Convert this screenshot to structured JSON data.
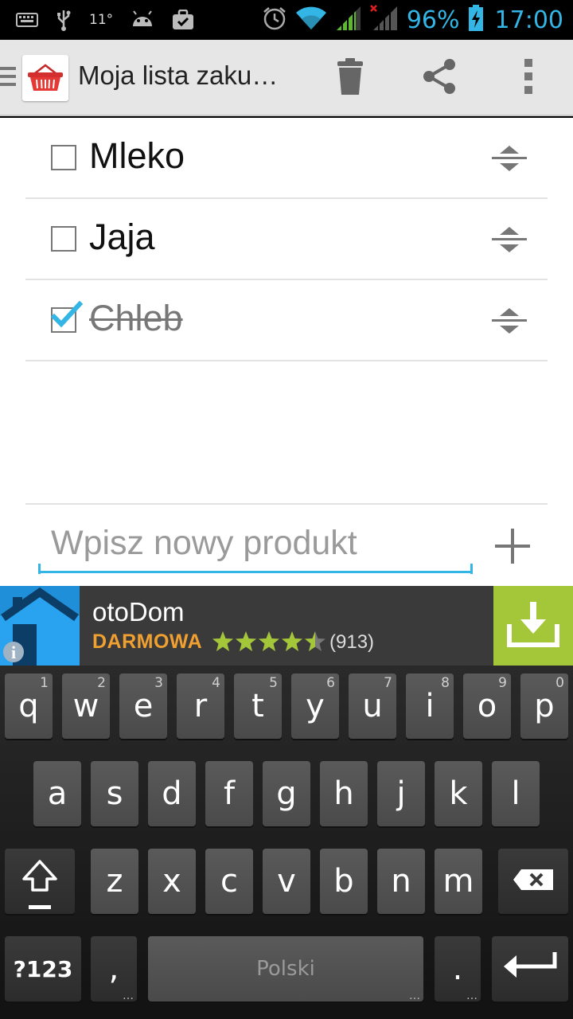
{
  "status_bar": {
    "temperature": "11°",
    "battery_percent": "96%",
    "time": "17:00",
    "icons": [
      "keyboard-icon",
      "usb-icon",
      "android-icon",
      "briefcase-icon",
      "alarm-icon",
      "wifi-icon",
      "signal-icon",
      "signal-no-service-icon",
      "battery-charging-icon"
    ]
  },
  "action_bar": {
    "title": "Moja lista zaku…",
    "actions": [
      "delete-icon",
      "share-icon",
      "overflow-menu-icon"
    ]
  },
  "list": {
    "items": [
      {
        "label": "Mleko",
        "checked": false
      },
      {
        "label": "Jaja",
        "checked": false
      },
      {
        "label": "Chleb",
        "checked": true
      }
    ]
  },
  "new_item": {
    "placeholder": "Wpisz nowy produkt",
    "value": ""
  },
  "ad": {
    "title": "otoDom",
    "price": "DARMOWA",
    "rating": 4.5,
    "rating_max": 5,
    "reviews": "(913)",
    "colors": {
      "price": "#f0a030",
      "stars": "#a4c639",
      "download_bg": "#a4c639"
    }
  },
  "keyboard": {
    "row1": [
      {
        "k": "q",
        "h": "1"
      },
      {
        "k": "w",
        "h": "2"
      },
      {
        "k": "e",
        "h": "3"
      },
      {
        "k": "r",
        "h": "4"
      },
      {
        "k": "t",
        "h": "5"
      },
      {
        "k": "y",
        "h": "6"
      },
      {
        "k": "u",
        "h": "7"
      },
      {
        "k": "i",
        "h": "8"
      },
      {
        "k": "o",
        "h": "9"
      },
      {
        "k": "p",
        "h": "0"
      }
    ],
    "row2": [
      "a",
      "s",
      "d",
      "f",
      "g",
      "h",
      "j",
      "k",
      "l"
    ],
    "row3": [
      "z",
      "x",
      "c",
      "v",
      "b",
      "n",
      "m"
    ],
    "symbols_label": "?123",
    "comma_label": ",",
    "space_label": "Polski",
    "period_label": "."
  },
  "accent_color": "#33b5e5"
}
